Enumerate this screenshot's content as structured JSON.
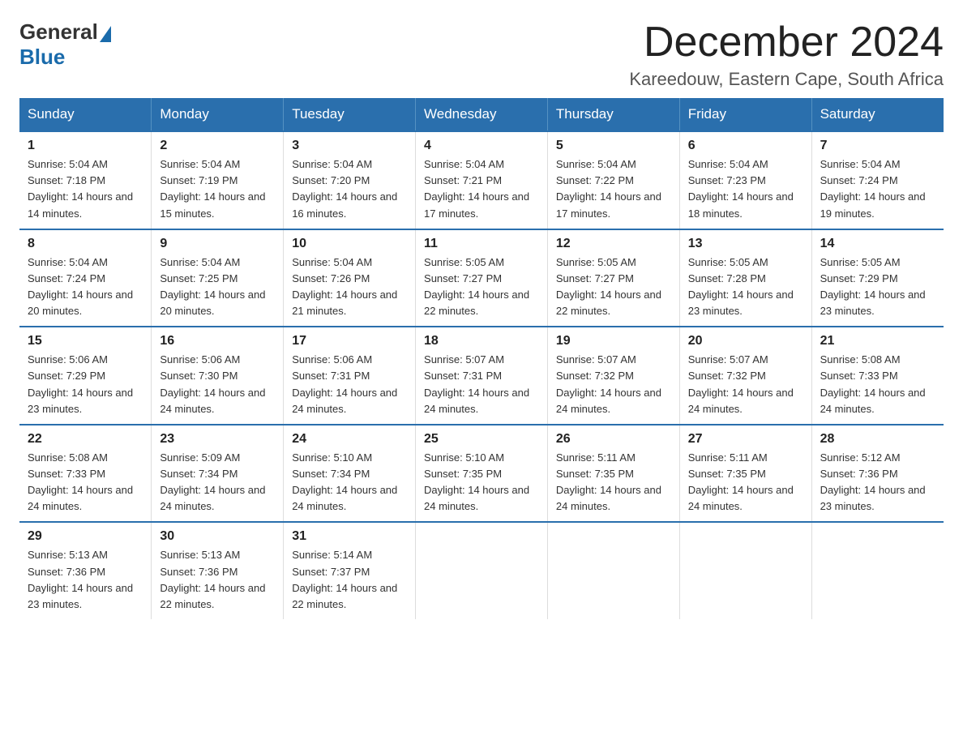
{
  "logo": {
    "general": "General",
    "blue": "Blue"
  },
  "title": "December 2024",
  "subtitle": "Kareedouw, Eastern Cape, South Africa",
  "headers": [
    "Sunday",
    "Monday",
    "Tuesday",
    "Wednesday",
    "Thursday",
    "Friday",
    "Saturday"
  ],
  "weeks": [
    [
      {
        "day": "1",
        "sunrise": "5:04 AM",
        "sunset": "7:18 PM",
        "daylight": "14 hours and 14 minutes."
      },
      {
        "day": "2",
        "sunrise": "5:04 AM",
        "sunset": "7:19 PM",
        "daylight": "14 hours and 15 minutes."
      },
      {
        "day": "3",
        "sunrise": "5:04 AM",
        "sunset": "7:20 PM",
        "daylight": "14 hours and 16 minutes."
      },
      {
        "day": "4",
        "sunrise": "5:04 AM",
        "sunset": "7:21 PM",
        "daylight": "14 hours and 17 minutes."
      },
      {
        "day": "5",
        "sunrise": "5:04 AM",
        "sunset": "7:22 PM",
        "daylight": "14 hours and 17 minutes."
      },
      {
        "day": "6",
        "sunrise": "5:04 AM",
        "sunset": "7:23 PM",
        "daylight": "14 hours and 18 minutes."
      },
      {
        "day": "7",
        "sunrise": "5:04 AM",
        "sunset": "7:24 PM",
        "daylight": "14 hours and 19 minutes."
      }
    ],
    [
      {
        "day": "8",
        "sunrise": "5:04 AM",
        "sunset": "7:24 PM",
        "daylight": "14 hours and 20 minutes."
      },
      {
        "day": "9",
        "sunrise": "5:04 AM",
        "sunset": "7:25 PM",
        "daylight": "14 hours and 20 minutes."
      },
      {
        "day": "10",
        "sunrise": "5:04 AM",
        "sunset": "7:26 PM",
        "daylight": "14 hours and 21 minutes."
      },
      {
        "day": "11",
        "sunrise": "5:05 AM",
        "sunset": "7:27 PM",
        "daylight": "14 hours and 22 minutes."
      },
      {
        "day": "12",
        "sunrise": "5:05 AM",
        "sunset": "7:27 PM",
        "daylight": "14 hours and 22 minutes."
      },
      {
        "day": "13",
        "sunrise": "5:05 AM",
        "sunset": "7:28 PM",
        "daylight": "14 hours and 23 minutes."
      },
      {
        "day": "14",
        "sunrise": "5:05 AM",
        "sunset": "7:29 PM",
        "daylight": "14 hours and 23 minutes."
      }
    ],
    [
      {
        "day": "15",
        "sunrise": "5:06 AM",
        "sunset": "7:29 PM",
        "daylight": "14 hours and 23 minutes."
      },
      {
        "day": "16",
        "sunrise": "5:06 AM",
        "sunset": "7:30 PM",
        "daylight": "14 hours and 24 minutes."
      },
      {
        "day": "17",
        "sunrise": "5:06 AM",
        "sunset": "7:31 PM",
        "daylight": "14 hours and 24 minutes."
      },
      {
        "day": "18",
        "sunrise": "5:07 AM",
        "sunset": "7:31 PM",
        "daylight": "14 hours and 24 minutes."
      },
      {
        "day": "19",
        "sunrise": "5:07 AM",
        "sunset": "7:32 PM",
        "daylight": "14 hours and 24 minutes."
      },
      {
        "day": "20",
        "sunrise": "5:07 AM",
        "sunset": "7:32 PM",
        "daylight": "14 hours and 24 minutes."
      },
      {
        "day": "21",
        "sunrise": "5:08 AM",
        "sunset": "7:33 PM",
        "daylight": "14 hours and 24 minutes."
      }
    ],
    [
      {
        "day": "22",
        "sunrise": "5:08 AM",
        "sunset": "7:33 PM",
        "daylight": "14 hours and 24 minutes."
      },
      {
        "day": "23",
        "sunrise": "5:09 AM",
        "sunset": "7:34 PM",
        "daylight": "14 hours and 24 minutes."
      },
      {
        "day": "24",
        "sunrise": "5:10 AM",
        "sunset": "7:34 PM",
        "daylight": "14 hours and 24 minutes."
      },
      {
        "day": "25",
        "sunrise": "5:10 AM",
        "sunset": "7:35 PM",
        "daylight": "14 hours and 24 minutes."
      },
      {
        "day": "26",
        "sunrise": "5:11 AM",
        "sunset": "7:35 PM",
        "daylight": "14 hours and 24 minutes."
      },
      {
        "day": "27",
        "sunrise": "5:11 AM",
        "sunset": "7:35 PM",
        "daylight": "14 hours and 24 minutes."
      },
      {
        "day": "28",
        "sunrise": "5:12 AM",
        "sunset": "7:36 PM",
        "daylight": "14 hours and 23 minutes."
      }
    ],
    [
      {
        "day": "29",
        "sunrise": "5:13 AM",
        "sunset": "7:36 PM",
        "daylight": "14 hours and 23 minutes."
      },
      {
        "day": "30",
        "sunrise": "5:13 AM",
        "sunset": "7:36 PM",
        "daylight": "14 hours and 22 minutes."
      },
      {
        "day": "31",
        "sunrise": "5:14 AM",
        "sunset": "7:37 PM",
        "daylight": "14 hours and 22 minutes."
      },
      null,
      null,
      null,
      null
    ]
  ],
  "labels": {
    "sunrise_prefix": "Sunrise: ",
    "sunset_prefix": "Sunset: ",
    "daylight_prefix": "Daylight: "
  }
}
